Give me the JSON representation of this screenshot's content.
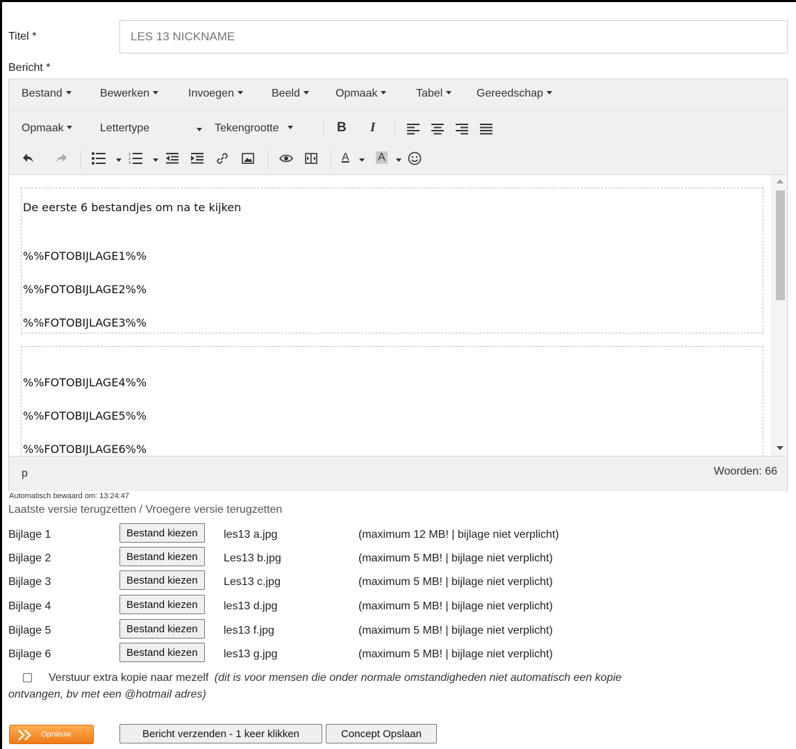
{
  "form": {
    "title_label": "Titel *",
    "title_value": "LES 13 NICKNAME",
    "message_label": "Bericht *"
  },
  "editor": {
    "menu": [
      "Bestand",
      "Bewerken",
      "Invoegen",
      "Beeld",
      "Opmaak",
      "Tabel",
      "Gereedschap"
    ],
    "format_dropdown": "Opmaak",
    "font_dropdown": "Lettertype",
    "fontsize_dropdown": "Tekengrootte",
    "bold_label": "B",
    "italic_label": "I",
    "text_color_label": "A",
    "bg_color_label": "A",
    "content": [
      "De eerste 6 bestandjes om na te kijken",
      "%%FOTOBIJLAGE1%%",
      "%%FOTOBIJLAGE2%%",
      "%%FOTOBIJLAGE3%%",
      "%%FOTOBIJLAGE4%%",
      "%%FOTOBIJLAGE5%%",
      "%%FOTOBIJLAGE6%%"
    ],
    "status_path": "p",
    "word_count": "Woorden: 66"
  },
  "autosave": {
    "text": "Automatisch bewaard om: 13:24:47",
    "restore_last": "Laatste versie terugzetten",
    "separator": " / ",
    "restore_older": "Vroegere versie terugzetten"
  },
  "attachments": [
    {
      "label": "Bijlage 1",
      "button": "Bestand kiezen",
      "file": "les13 a.jpg",
      "note": "(maximum 12 MB! | bijlage niet verplicht)"
    },
    {
      "label": "Bijlage 2",
      "button": "Bestand kiezen",
      "file": "Les13 b.jpg",
      "note": "(maximum 5 MB! | bijlage niet verplicht)"
    },
    {
      "label": "Bijlage 3",
      "button": "Bestand kiezen",
      "file": "Les13 c.jpg",
      "note": "(maximum 5 MB! | bijlage niet verplicht)"
    },
    {
      "label": "Bijlage 4",
      "button": "Bestand kiezen",
      "file": "les13 d.jpg",
      "note": "(maximum 5 MB! | bijlage niet verplicht)"
    },
    {
      "label": "Bijlage 5",
      "button": "Bestand kiezen",
      "file": "les13 f.jpg",
      "note": "(maximum 5 MB! | bijlage niet verplicht)"
    },
    {
      "label": "Bijlage 6",
      "button": "Bestand kiezen",
      "file": "les13 g.jpg",
      "note": "(maximum 5 MB! | bijlage niet verplicht)"
    }
  ],
  "copy_option": {
    "label": "Verstuur extra kopie naar mezelf",
    "note_line1": "(dit is voor mensen die onder normale omstandigheden niet automatisch een kopie",
    "note_line2": "ontvangen, bv met een @hotmail adres)"
  },
  "actions": {
    "reset_label": "Opnieuw",
    "send_label": "Bericht verzenden - 1 keer klikken",
    "draft_label": "Concept Opslaan"
  },
  "icons": [
    "undo-icon",
    "redo-icon",
    "bullet-list-icon",
    "numbered-list-icon",
    "outdent-icon",
    "indent-icon",
    "link-icon",
    "image-icon",
    "preview-icon",
    "media-icon",
    "text-color-icon",
    "background-color-icon",
    "emoticon-icon",
    "align-left-icon",
    "align-center-icon",
    "align-right-icon",
    "justify-icon"
  ],
  "colors": {
    "accent_orange": "#f07a14",
    "toolbar_bg": "#f0f0f0",
    "border": "#cfcfcf"
  }
}
